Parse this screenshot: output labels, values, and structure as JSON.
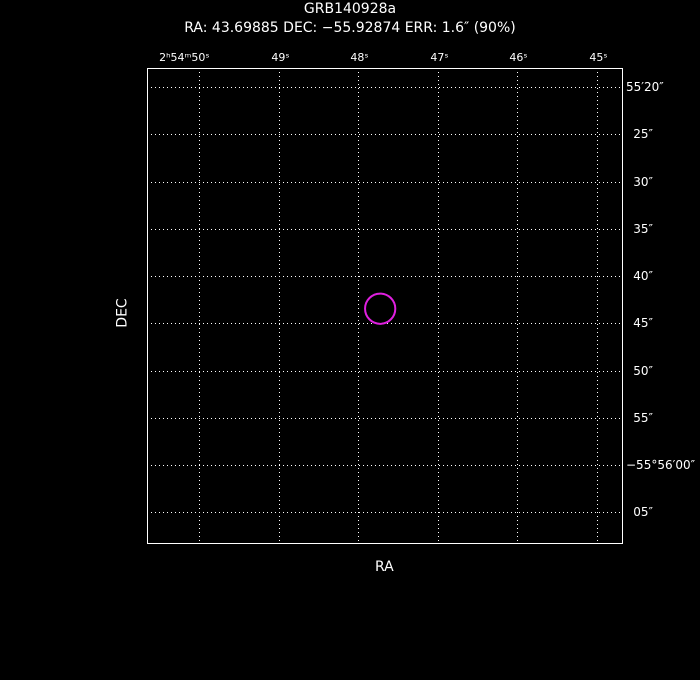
{
  "colors": {
    "background": "#000000",
    "foreground": "#ffffff",
    "marker": "#e020e0"
  },
  "header": {
    "title": "GRB140928a",
    "subtitle": "RA: 43.69885  DEC: −55.92874  ERR: 1.6″ (90%)"
  },
  "chart_data": {
    "type": "scatter",
    "title": "GRB140928a",
    "xlabel": "RA",
    "ylabel": "DEC",
    "grid": true,
    "x_ticks": [
      {
        "value_sec": 50,
        "label": "2ʰ54ᵐ50ˢ"
      },
      {
        "value_sec": 49,
        "label": "49ˢ"
      },
      {
        "value_sec": 48,
        "label": "48ˢ"
      },
      {
        "value_sec": 47,
        "label": "47ˢ"
      },
      {
        "value_sec": 46,
        "label": "46ˢ"
      },
      {
        "value_sec": 45,
        "label": "45ˢ"
      }
    ],
    "y_ticks": [
      {
        "value_arcsec": 20,
        "label": "55′20″"
      },
      {
        "value_arcsec": 25,
        "label": "25″"
      },
      {
        "value_arcsec": 30,
        "label": "30″"
      },
      {
        "value_arcsec": 35,
        "label": "35″"
      },
      {
        "value_arcsec": 40,
        "label": "40″"
      },
      {
        "value_arcsec": 45,
        "label": "45″"
      },
      {
        "value_arcsec": 50,
        "label": "50″"
      },
      {
        "value_arcsec": 55,
        "label": "55″"
      },
      {
        "value_arcsec": 60,
        "label": "−55°56′00″"
      },
      {
        "value_arcsec": 65,
        "label": "05″"
      }
    ],
    "points": [
      {
        "ra_deg": 43.69885,
        "dec_deg": -55.92874,
        "err_arcsec": 1.6,
        "ra_sec": 47.724,
        "dec_arcsec_below_55": 43.46
      }
    ]
  }
}
